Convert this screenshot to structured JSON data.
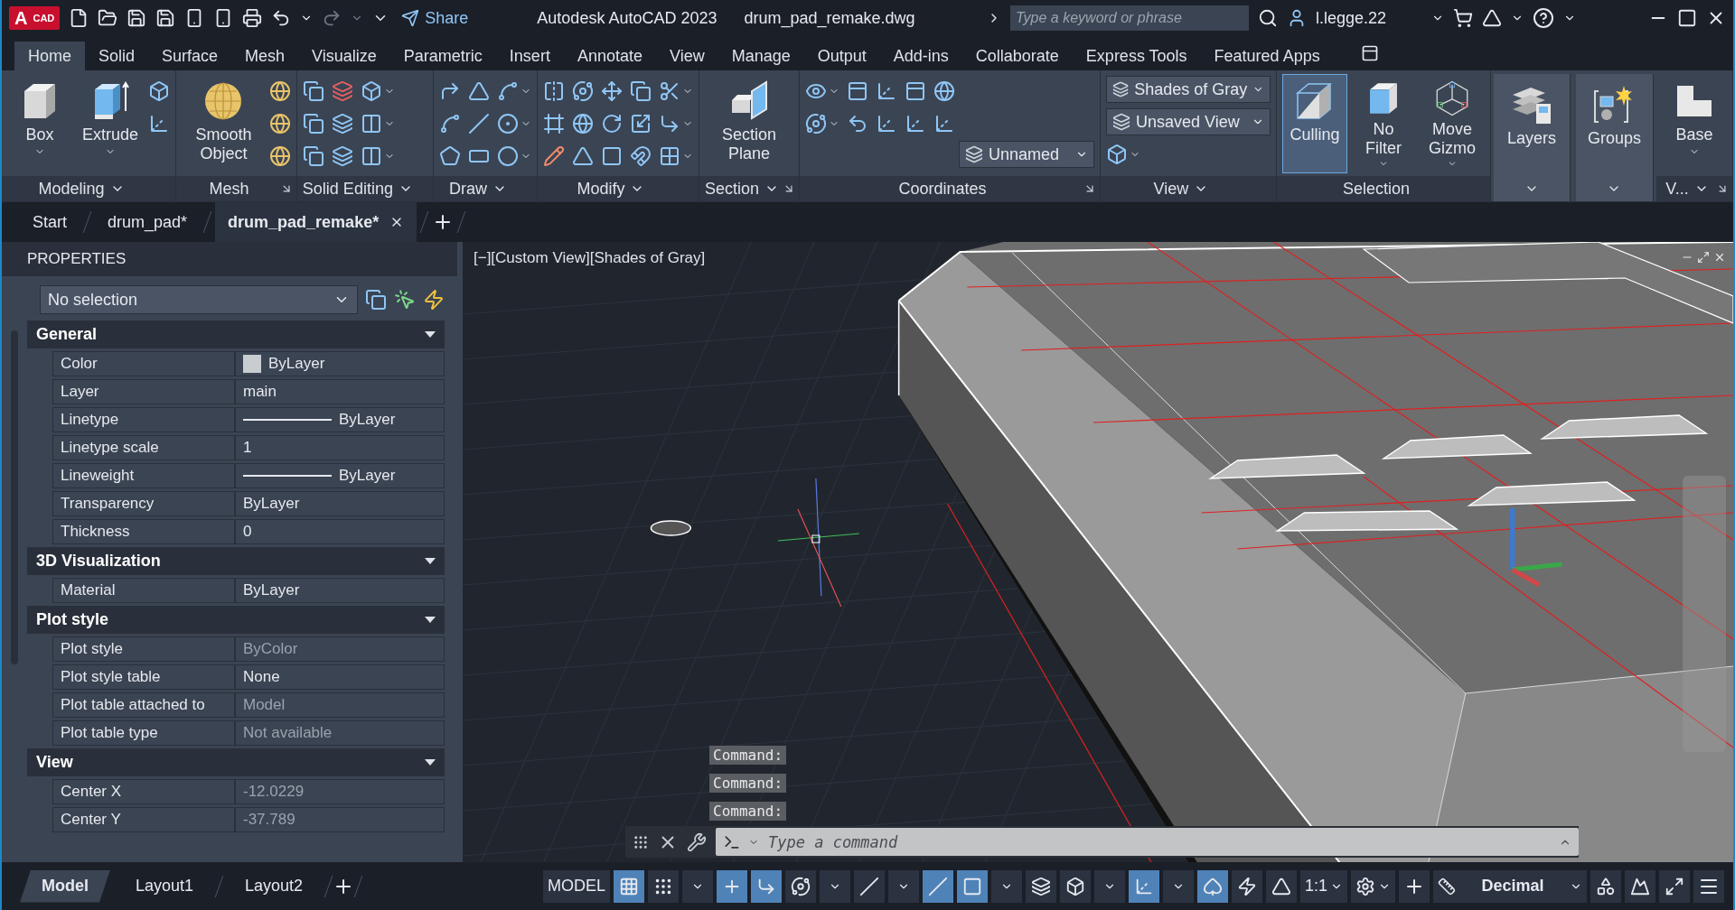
{
  "title_bar": {
    "logo": "A",
    "logo_badge": "CAD",
    "share": "Share",
    "app_title": "Autodesk AutoCAD 2023",
    "file_name": "drum_pad_remake.dwg",
    "search": {
      "placeholder": "Type a keyword or phrase"
    },
    "user": "l.legge.22"
  },
  "ribbon_tabs": [
    {
      "label": "Home",
      "selected": true
    },
    {
      "label": "Solid",
      "selected": false
    },
    {
      "label": "Surface",
      "selected": false
    },
    {
      "label": "Mesh",
      "selected": false
    },
    {
      "label": "Visualize",
      "selected": false
    },
    {
      "label": "Parametric",
      "selected": false
    },
    {
      "label": "Insert",
      "selected": false
    },
    {
      "label": "Annotate",
      "selected": false
    },
    {
      "label": "View",
      "selected": false
    },
    {
      "label": "Manage",
      "selected": false
    },
    {
      "label": "Output",
      "selected": false
    },
    {
      "label": "Add-ins",
      "selected": false
    },
    {
      "label": "Collaborate",
      "selected": false
    },
    {
      "label": "Express Tools",
      "selected": false
    },
    {
      "label": "Featured Apps",
      "selected": false
    }
  ],
  "ribbon_panels": [
    {
      "title": "Modeling",
      "menu": true,
      "launcher": false,
      "collapsed": false,
      "large_buttons": [
        {
          "label": "Box",
          "has_menu": true,
          "selected": false
        },
        {
          "label": "Extrude",
          "has_menu": true,
          "selected": false
        }
      ]
    },
    {
      "title": "Mesh",
      "menu": false,
      "launcher": true,
      "collapsed": false,
      "large_buttons": [
        {
          "label": "Smooth Object",
          "has_menu": false,
          "selected": false
        }
      ]
    },
    {
      "title": "Solid Editing",
      "menu": true,
      "launcher": false,
      "collapsed": false
    },
    {
      "title": "Draw",
      "menu": true,
      "launcher": false,
      "collapsed": false
    },
    {
      "title": "Modify",
      "menu": true,
      "launcher": false,
      "collapsed": false
    },
    {
      "title": "Section",
      "menu": true,
      "launcher": true,
      "collapsed": false,
      "large_buttons": [
        {
          "label": "Section Plane",
          "has_menu": false,
          "selected": false
        }
      ]
    },
    {
      "title": "Coordinates",
      "menu": false,
      "launcher": true,
      "collapsed": false,
      "dropdowns": [
        "Unnamed"
      ]
    },
    {
      "title": "View",
      "menu": true,
      "launcher": false,
      "collapsed": false,
      "dropdowns": [
        "Shades of Gray",
        "Unsaved View"
      ]
    },
    {
      "title": "Selection",
      "menu": false,
      "launcher": false,
      "collapsed": false,
      "large_buttons": [
        {
          "label": "Culling",
          "has_menu": false,
          "selected": true
        },
        {
          "label": "No Filter",
          "has_menu": true,
          "selected": false
        },
        {
          "label": "Move Gizmo",
          "has_menu": true,
          "selected": false
        }
      ]
    },
    {
      "menu": true,
      "collapsed": true,
      "large_buttons": [
        {
          "label": "Layers",
          "has_menu": false,
          "selected": false
        }
      ]
    },
    {
      "menu": true,
      "collapsed": true,
      "large_buttons": [
        {
          "label": "Groups",
          "has_menu": false,
          "selected": false
        }
      ]
    },
    {
      "title": "V...",
      "menu": true,
      "launcher": true,
      "collapsed": false,
      "large_buttons": [
        {
          "label": "Base",
          "has_menu": true,
          "selected": false
        }
      ]
    }
  ],
  "doc_tabs": [
    {
      "label": "Start",
      "selected": false
    },
    {
      "label": "drum_pad*",
      "selected": false
    },
    {
      "label": "drum_pad_remake*",
      "selected": true
    }
  ],
  "properties": {
    "title": "PROPERTIES",
    "selection": "No selection",
    "sections": [
      {
        "title": "General",
        "expanded": true,
        "rows": [
          {
            "label": "Color",
            "value": "ByLayer",
            "kind": "swatch",
            "disabled": false
          },
          {
            "label": "Layer",
            "value": "main",
            "kind": "text",
            "disabled": false
          },
          {
            "label": "Linetype",
            "value": "ByLayer",
            "kind": "line",
            "disabled": false
          },
          {
            "label": "Linetype scale",
            "value": "1",
            "kind": "text",
            "disabled": false
          },
          {
            "label": "Lineweight",
            "value": "ByLayer",
            "kind": "line",
            "disabled": false
          },
          {
            "label": "Transparency",
            "value": "ByLayer",
            "kind": "text",
            "disabled": false
          },
          {
            "label": "Thickness",
            "value": "0",
            "kind": "text",
            "disabled": false
          }
        ]
      },
      {
        "title": "3D Visualization",
        "expanded": true,
        "rows": [
          {
            "label": "Material",
            "value": "ByLayer",
            "kind": "text",
            "disabled": false
          }
        ]
      },
      {
        "title": "Plot style",
        "expanded": true,
        "rows": [
          {
            "label": "Plot style",
            "value": "ByColor",
            "kind": "text",
            "disabled": true
          },
          {
            "label": "Plot style table",
            "value": "None",
            "kind": "text",
            "disabled": false
          },
          {
            "label": "Plot table attached to",
            "value": "Model",
            "kind": "text",
            "disabled": true
          },
          {
            "label": "Plot table type",
            "value": "Not available",
            "kind": "text",
            "disabled": true
          }
        ]
      },
      {
        "title": "View",
        "expanded": true,
        "rows": [
          {
            "label": "Center X",
            "value": "-12.0229",
            "kind": "text",
            "disabled": true
          },
          {
            "label": "Center Y",
            "value": "-37.789",
            "kind": "text",
            "disabled": true
          }
        ]
      }
    ]
  },
  "viewport": {
    "label": "[−][Custom View][Shades of Gray]",
    "history": [
      "Command:",
      "Command:",
      "Command:"
    ],
    "command": {
      "placeholder": "Type a command"
    }
  },
  "layout_tabs": [
    {
      "label": "Model",
      "selected": true
    },
    {
      "label": "Layout1",
      "selected": false
    },
    {
      "label": "Layout2",
      "selected": false
    }
  ],
  "status_bar": {
    "model": "MODEL",
    "scale": "1:1",
    "units": "Decimal",
    "toggles": [
      {
        "on": true
      },
      {
        "on": false
      },
      {
        "on": true
      },
      {
        "on": true
      },
      {
        "on": false
      },
      {
        "on": false
      },
      {
        "on": true
      },
      {
        "on": true
      },
      {
        "on": false
      },
      {
        "on": false
      },
      {
        "on": true
      },
      {
        "on": true
      },
      {
        "on": false
      },
      {
        "on": false
      }
    ]
  }
}
